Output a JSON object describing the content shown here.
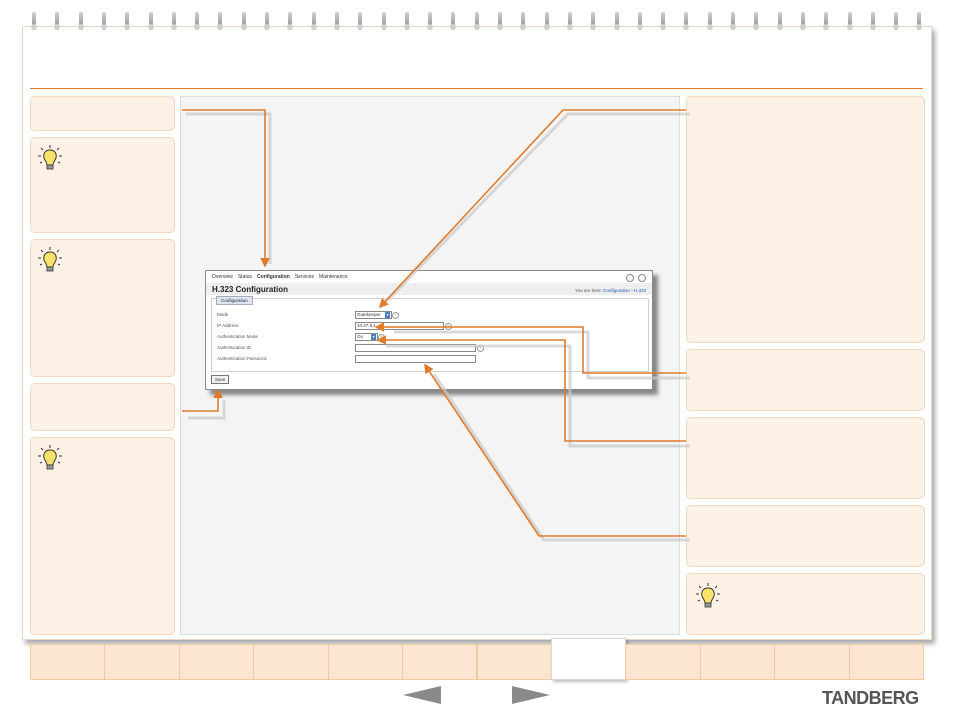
{
  "screenshot": {
    "nav": [
      "Overview",
      "Status",
      "Configuration",
      "Services",
      "Maintenance"
    ],
    "active_nav": "Configuration",
    "title": "H.323 Configuration",
    "breadcrumb_prefix": "You are here:",
    "breadcrumb_section": "Configuration",
    "breadcrumb_sep": "›",
    "breadcrumb_page": "H.323",
    "panel_label": "Configuration",
    "fields": {
      "mode_label": "Mode",
      "mode_value": "Gatekeeper",
      "ip_label": "IP Address",
      "ip_value": "10.47.9.1",
      "auth_mode_label": "Authentication Mode",
      "auth_mode_value": "On",
      "auth_id_label": "Authentication ID",
      "auth_id_value": "",
      "auth_pw_label": "Authentication Password",
      "auth_pw_value": ""
    },
    "help_glyph": "?",
    "save_label": "Save"
  },
  "nav_prev_icon": "prev-arrow-icon",
  "nav_next_icon": "next-arrow-icon",
  "brand": "TANDBERG",
  "colors": {
    "accent": "#e07b2c",
    "box_bg": "#fdf1e6",
    "tab_bg": "#fbe5d1"
  }
}
